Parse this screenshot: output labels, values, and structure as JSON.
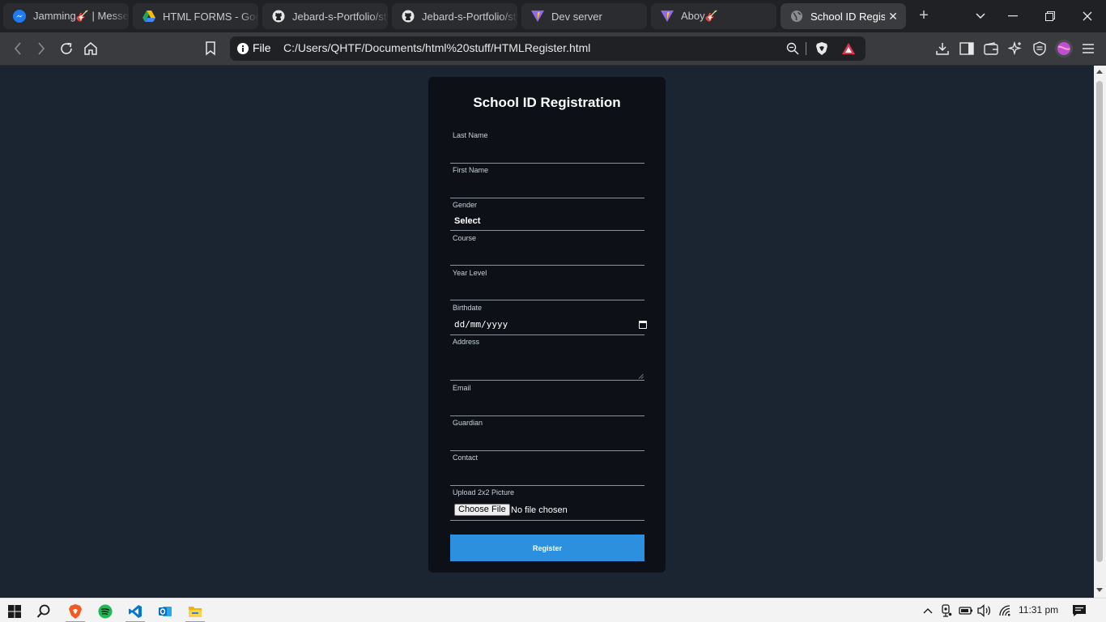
{
  "browser": {
    "tabs": [
      {
        "label": "Jamming🎸 | Messenger",
        "icon": "messenger-icon"
      },
      {
        "label": "HTML FORMS - Google Drive",
        "icon": "google-drive-icon"
      },
      {
        "label": "Jebard-s-Portfolio/style",
        "icon": "github-icon"
      },
      {
        "label": "Jebard-s-Portfolio/style",
        "icon": "github-icon"
      },
      {
        "label": "Dev server",
        "icon": "vite-icon"
      },
      {
        "label": "Aboy🎸",
        "icon": "vite-icon"
      },
      {
        "label": "School ID Registration",
        "icon": "globe-icon",
        "active": true
      }
    ],
    "address": {
      "scheme_label": "File",
      "url": "C:/Users/QHTF/Documents/html%20stuff/HTMLRegister.html"
    }
  },
  "form": {
    "title": "School ID Registration",
    "fields": {
      "last_name": {
        "label": "Last Name",
        "value": ""
      },
      "first_name": {
        "label": "First Name",
        "value": ""
      },
      "gender": {
        "label": "Gender",
        "selected": "Select"
      },
      "course": {
        "label": "Course",
        "value": ""
      },
      "year_level": {
        "label": "Year Level",
        "value": ""
      },
      "birthdate": {
        "label": "Birthdate",
        "value": "dd/mm/yyyy"
      },
      "address": {
        "label": "Address",
        "value": ""
      },
      "email": {
        "label": "Email",
        "value": ""
      },
      "guardian": {
        "label": "Guardian",
        "value": ""
      },
      "contact": {
        "label": "Contact",
        "value": ""
      },
      "picture": {
        "label": "Upload 2x2 Picture",
        "button": "Choose File",
        "status": "No file chosen"
      }
    },
    "submit_label": "Register"
  },
  "taskbar": {
    "apps": [
      "windows-start-icon",
      "search-icon",
      "brave-icon",
      "spotify-icon",
      "vscode-icon",
      "outlook-icon",
      "file-explorer-icon"
    ],
    "clock": "11:31 pm"
  },
  "colors": {
    "page_background": "#1b2431",
    "card_background": "#0d1117",
    "accent_button": "#2d90de"
  }
}
